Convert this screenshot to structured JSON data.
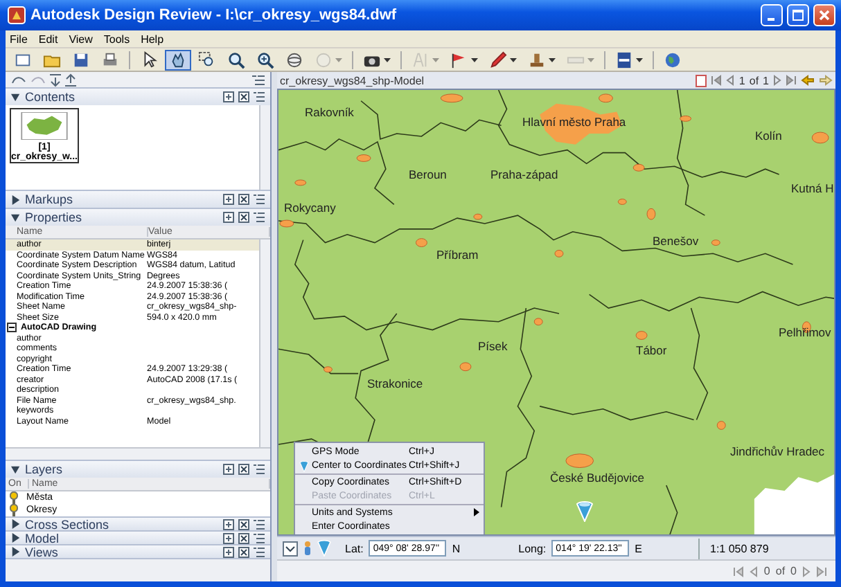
{
  "window": {
    "title": "Autodesk Design Review - I:\\cr_okresy_wgs84.dwf"
  },
  "menu": [
    {
      "label": "File"
    },
    {
      "label": "Edit"
    },
    {
      "label": "View"
    },
    {
      "label": "Tools"
    },
    {
      "label": "Help"
    }
  ],
  "toolbar": [
    {
      "selected": false,
      "disabled": false
    },
    {
      "selected": false,
      "disabled": false
    },
    {
      "selected": false,
      "disabled": false
    },
    {
      "selected": false,
      "disabled": false
    },
    {
      "selected": false,
      "disabled": false
    },
    {
      "selected": true,
      "disabled": false
    },
    {
      "selected": false,
      "disabled": false
    },
    {
      "selected": false,
      "disabled": false
    },
    {
      "selected": false,
      "disabled": false
    },
    {
      "selected": false,
      "disabled": false
    },
    {
      "selected": false,
      "disabled": true
    },
    {
      "selected": false,
      "disabled": false
    },
    {
      "selected": false,
      "disabled": true
    },
    {
      "selected": false,
      "disabled": false
    },
    {
      "selected": false,
      "disabled": false
    },
    {
      "selected": false,
      "disabled": false
    },
    {
      "selected": false,
      "disabled": true
    },
    {
      "selected": false,
      "disabled": false
    },
    {
      "selected": false,
      "disabled": false
    }
  ],
  "panels": [
    {
      "kind": "contents",
      "title": "Contents",
      "expanded": true,
      "thumbnails": [
        {
          "index": "[1]",
          "label": "cr_okresy_w...",
          "selected": true
        }
      ]
    },
    {
      "kind": "header",
      "title": "Markups",
      "expanded": false
    },
    {
      "kind": "properties",
      "title": "Properties",
      "expanded": true,
      "columns": [
        "Name",
        "Value"
      ],
      "rows": [
        {
          "name": "author",
          "value": "binterj",
          "selected": true
        },
        {
          "name": "Coordinate System Datum Name",
          "value": "WGS84",
          "selected": false
        },
        {
          "name": "Coordinate System Description",
          "value": "WGS84 datum, Latitud",
          "selected": false
        },
        {
          "name": "Coordinate System Units_String",
          "value": "Degrees",
          "selected": false
        },
        {
          "name": "Creation Time",
          "value": "24.9.2007  15:38:36  (",
          "selected": false
        },
        {
          "name": "Modification Time",
          "value": "24.9.2007  15:38:36  (",
          "selected": false
        },
        {
          "name": "Sheet Name",
          "value": "cr_okresy_wgs84_shp-",
          "selected": false
        },
        {
          "name": "Sheet Size",
          "value": "594.0 x 420.0 mm",
          "selected": false
        }
      ],
      "groups": [
        {
          "title": "AutoCAD Drawing",
          "expanded": true,
          "rows": [
            {
              "name": "author",
              "value": "",
              "selected": false
            },
            {
              "name": "comments",
              "value": "",
              "selected": false
            },
            {
              "name": "copyright",
              "value": "",
              "selected": false
            },
            {
              "name": "Creation Time",
              "value": "24.9.2007  13:29:38  (",
              "selected": false
            },
            {
              "name": "creator",
              "value": "AutoCAD 2008 (17.1s (",
              "selected": false
            },
            {
              "name": "description",
              "value": "",
              "selected": false
            },
            {
              "name": "File Name",
              "value": "cr_okresy_wgs84_shp.",
              "selected": false
            },
            {
              "name": "keywords",
              "value": "",
              "selected": false
            },
            {
              "name": "Layout Name",
              "value": "Model",
              "selected": false
            }
          ]
        }
      ]
    },
    {
      "kind": "layers",
      "title": "Layers",
      "expanded": true,
      "columns": [
        "On",
        "Name"
      ],
      "rows": [
        {
          "name": "Města",
          "on": true
        },
        {
          "name": "Okresy",
          "on": true
        }
      ]
    },
    {
      "kind": "header",
      "title": "Cross Sections",
      "expanded": false
    },
    {
      "kind": "header",
      "title": "Model",
      "expanded": false
    },
    {
      "kind": "header",
      "title": "Views",
      "expanded": false
    }
  ],
  "document": {
    "tab": "cr_okresy_wgs84_shp-Model",
    "page": "1",
    "of": "of",
    "total": "1"
  },
  "map": {
    "labels": [
      {
        "name": "Rakovník"
      },
      {
        "name": "Hlavní město Praha"
      },
      {
        "name": "Kolín"
      },
      {
        "name": "Beroun"
      },
      {
        "name": "Praha-západ"
      },
      {
        "name": "Kutná H"
      },
      {
        "name": "Rokycany"
      },
      {
        "name": "Benešov"
      },
      {
        "name": "Příbram"
      },
      {
        "name": "Pelhřimov"
      },
      {
        "name": "Písek"
      },
      {
        "name": "Tábor"
      },
      {
        "name": "Strakonice"
      },
      {
        "name": "Jindřichův Hradec"
      },
      {
        "name": "České Budějovice"
      }
    ]
  },
  "context_menu": {
    "items": [
      {
        "kind": "plain",
        "label": "GPS Mode",
        "shortcut": "Ctrl+J",
        "disabled": false,
        "separator_before": false
      },
      {
        "kind": "gps",
        "label": "Center to Coordinates",
        "shortcut": "Ctrl+Shift+J",
        "disabled": false,
        "separator_before": false
      },
      {
        "kind": "plain",
        "label": "Copy Coordinates",
        "shortcut": "Ctrl+Shift+D",
        "disabled": false,
        "separator_before": true
      },
      {
        "kind": "plain",
        "label": "Paste Coordinates",
        "shortcut": "Ctrl+L",
        "disabled": true,
        "separator_before": false
      },
      {
        "kind": "submenu",
        "label": "Units and Systems",
        "disabled": false,
        "separator_before": true
      },
      {
        "kind": "plain",
        "label": "Enter Coordinates",
        "disabled": false,
        "separator_before": false
      }
    ]
  },
  "coordinates": {
    "lat_label": "Lat:",
    "lat": "049° 08' 28.97''",
    "lat_hemisphere": "N",
    "long_label": "Long:",
    "long": "014° 19' 22.13''",
    "long_hemisphere": "E",
    "scale": "1:1 050 879"
  },
  "bottom_nav": {
    "page": "0",
    "of": "of",
    "total": "0"
  }
}
